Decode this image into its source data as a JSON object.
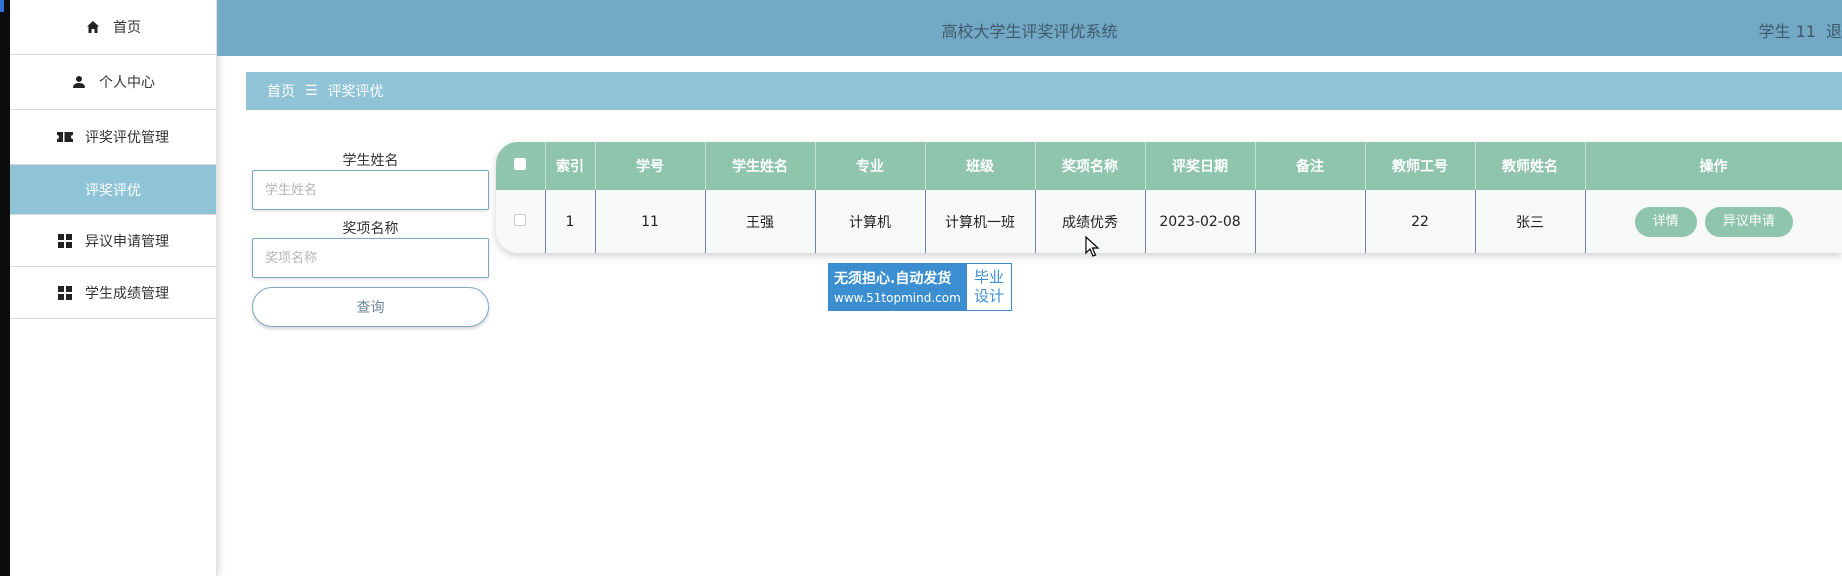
{
  "app": {
    "title": "高校大学生评奖评优系统",
    "user_label": "学生 11",
    "logout_label": "退"
  },
  "sidebar": {
    "items": [
      {
        "label": "首页",
        "icon": "home-icon"
      },
      {
        "label": "个人中心",
        "icon": "user-icon"
      },
      {
        "label": "评奖评优管理",
        "icon": "ticket-icon"
      },
      {
        "label": "评奖评优",
        "icon": "",
        "active": true
      },
      {
        "label": "异议申请管理",
        "icon": "grid-icon"
      },
      {
        "label": "学生成绩管理",
        "icon": "grid-icon"
      }
    ]
  },
  "breadcrumb": {
    "home": "首页",
    "separator": "☰",
    "current": "评奖评优"
  },
  "search": {
    "student_name_label": "学生姓名",
    "student_name_placeholder": "学生姓名",
    "award_name_label": "奖项名称",
    "award_name_placeholder": "奖项名称",
    "query_button": "查询"
  },
  "table": {
    "headers": [
      "索引",
      "学号",
      "学生姓名",
      "专业",
      "班级",
      "奖项名称",
      "评奖日期",
      "备注",
      "教师工号",
      "教师姓名",
      "操作"
    ],
    "rows": [
      {
        "index": "1",
        "student_id": "11",
        "student_name": "王强",
        "major": "计算机",
        "class": "计算机一班",
        "award_name": "成绩优秀",
        "award_date": "2023-02-08",
        "remark": "",
        "teacher_id": "22",
        "teacher_name": "张三",
        "actions": [
          "详情",
          "异议申请"
        ]
      }
    ]
  },
  "banner": {
    "line1": "无须担心.自动发货",
    "line2": "www.51topmind.com",
    "right1": "毕业",
    "right2": "设计"
  },
  "colors": {
    "topbar": "#74a9c6",
    "breadcrumb": "#8fc3d5",
    "sidebar_active": "#8ec4d6",
    "table_header": "#8fc4ad",
    "banner_blue": "#3b8fd0"
  }
}
